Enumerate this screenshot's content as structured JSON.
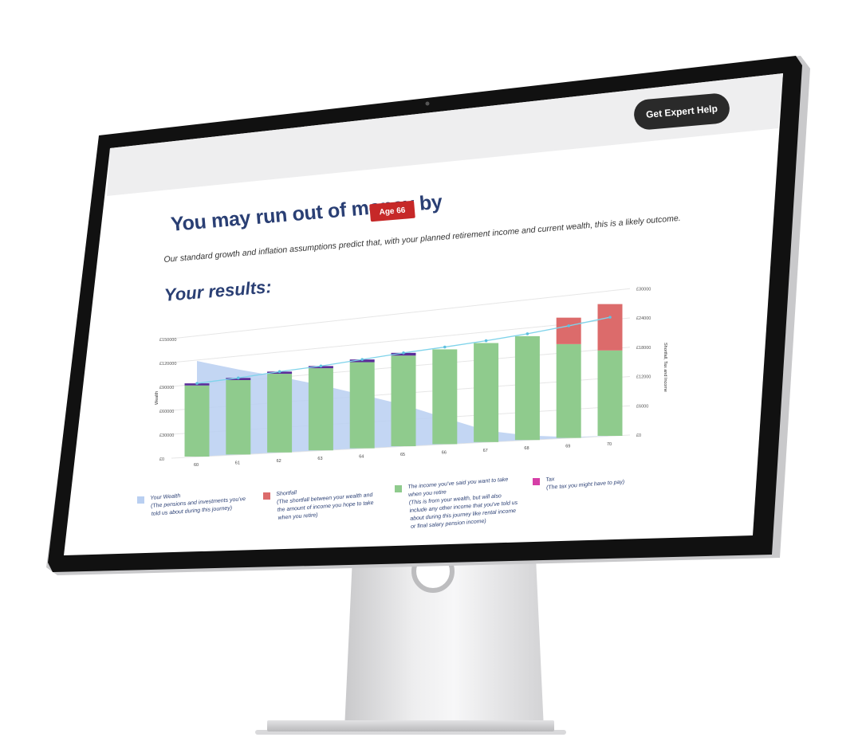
{
  "header": {
    "cta_label": "Get Expert Help"
  },
  "headline": {
    "text": "You may run out of money by",
    "badge": "Age 66",
    "description": "Our standard growth and inflation assumptions predict that, with your planned retirement income and current wealth, this is a likely outcome."
  },
  "results": {
    "heading": "Your results:"
  },
  "colors": {
    "wealth": "#b9cff1",
    "income": "#8fcb8d",
    "shortfall": "#dc6b6b",
    "tax": "#5b2d9a",
    "trend": "#7fd3ea",
    "accent": "#2a3f74",
    "badge": "#c62828"
  },
  "chart_data": {
    "type": "bar",
    "x": [
      "60",
      "61",
      "62",
      "63",
      "64",
      "65",
      "66",
      "67",
      "68",
      "69",
      "70"
    ],
    "left_axis": {
      "label": "Wealth",
      "ticks": [
        "£0",
        "£30000",
        "£60000",
        "£90000",
        "£120000",
        "£150000"
      ],
      "ylim": [
        0,
        150000
      ]
    },
    "right_axis": {
      "label": "Shortfall, Tax and Income",
      "ticks": [
        "£0",
        "£6000",
        "£12000",
        "£18000",
        "£24000",
        "£30000"
      ],
      "ylim": [
        0,
        30000
      ]
    },
    "series": [
      {
        "name": "Your Wealth",
        "type": "area",
        "axis": "left",
        "values": [
          120000,
          105000,
          92000,
          78000,
          63000,
          48000,
          30000,
          13000,
          5000,
          1000,
          0
        ]
      },
      {
        "name": "The income you've said you want to take when you retire",
        "type": "bar",
        "axis": "right",
        "values": [
          17000,
          17500,
          18200,
          18700,
          19300,
          20000,
          20600,
          21200,
          21900,
          19500,
          17500
        ]
      },
      {
        "name": "Shortfall",
        "type": "bar",
        "axis": "right",
        "values": [
          0,
          0,
          0,
          0,
          0,
          0,
          0,
          0,
          0,
          5500,
          9500
        ]
      },
      {
        "name": "Tax",
        "type": "bar",
        "axis": "right",
        "values": [
          500,
          500,
          500,
          500,
          600,
          600,
          0,
          0,
          0,
          0,
          0
        ]
      },
      {
        "name": "trend",
        "type": "line",
        "axis": "right",
        "values": [
          17500,
          18000,
          18700,
          19200,
          19900,
          20600,
          21100,
          21700,
          22400,
          23300,
          24300
        ]
      }
    ]
  },
  "legend": [
    {
      "title": "Your Wealth",
      "desc": "(The pensions and investments you've told us about during this journey)",
      "color": "#b9cff1"
    },
    {
      "title": "Shortfall",
      "desc": "(The shortfall between your wealth and the amount of income you hope to take when you retire)",
      "color": "#dc6b6b"
    },
    {
      "title": "The income you've said you want to take when you retire",
      "desc": "(This is from your wealth, but will also include any other income that you've told us about during this journey like rental income or final salary pension income)",
      "color": "#8fcb8d"
    },
    {
      "title": "Tax",
      "desc": "(The tax you might have to pay)",
      "color": "#d63fa7"
    }
  ]
}
